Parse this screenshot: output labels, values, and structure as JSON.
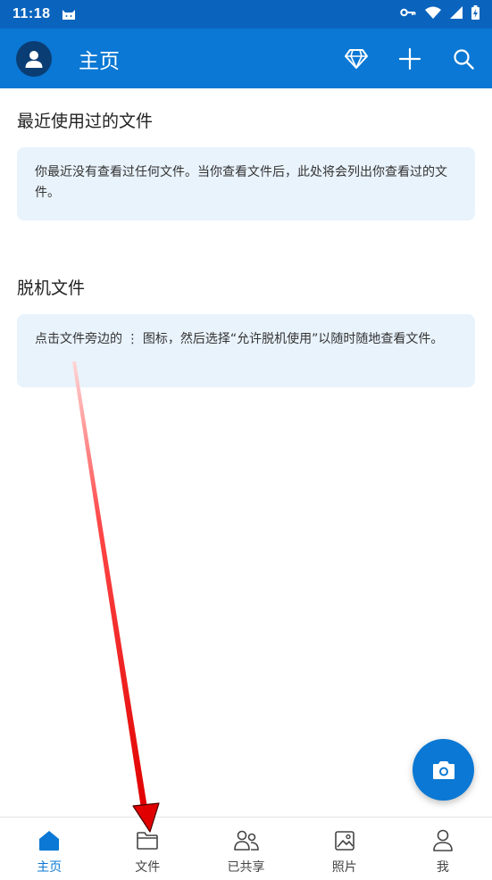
{
  "status_bar": {
    "time": "11:18"
  },
  "app_bar": {
    "title": "主页"
  },
  "recent": {
    "title": "最近使用过的文件",
    "message": "你最近没有查看过任何文件。当你查看文件后，此处将会列出你查看过的文件。"
  },
  "offline": {
    "title": "脱机文件",
    "message": "点击文件旁边的 ⋮ 图标，然后选择“允许脱机使用”以随时随地查看文件。"
  },
  "bottom_nav": {
    "items": [
      {
        "label": "主页",
        "icon": "home-icon",
        "active": true
      },
      {
        "label": "文件",
        "icon": "folder-icon",
        "active": false
      },
      {
        "label": "已共享",
        "icon": "people-icon",
        "active": false
      },
      {
        "label": "照片",
        "icon": "photo-icon",
        "active": false
      },
      {
        "label": "我",
        "icon": "person-icon",
        "active": false
      }
    ]
  },
  "colors": {
    "status_bar": "#0a64bd",
    "app_bar": "#0a78d4",
    "card_bg": "#e9f3fc",
    "accent": "#0a78d4",
    "annotation_arrow": "#e10000"
  }
}
